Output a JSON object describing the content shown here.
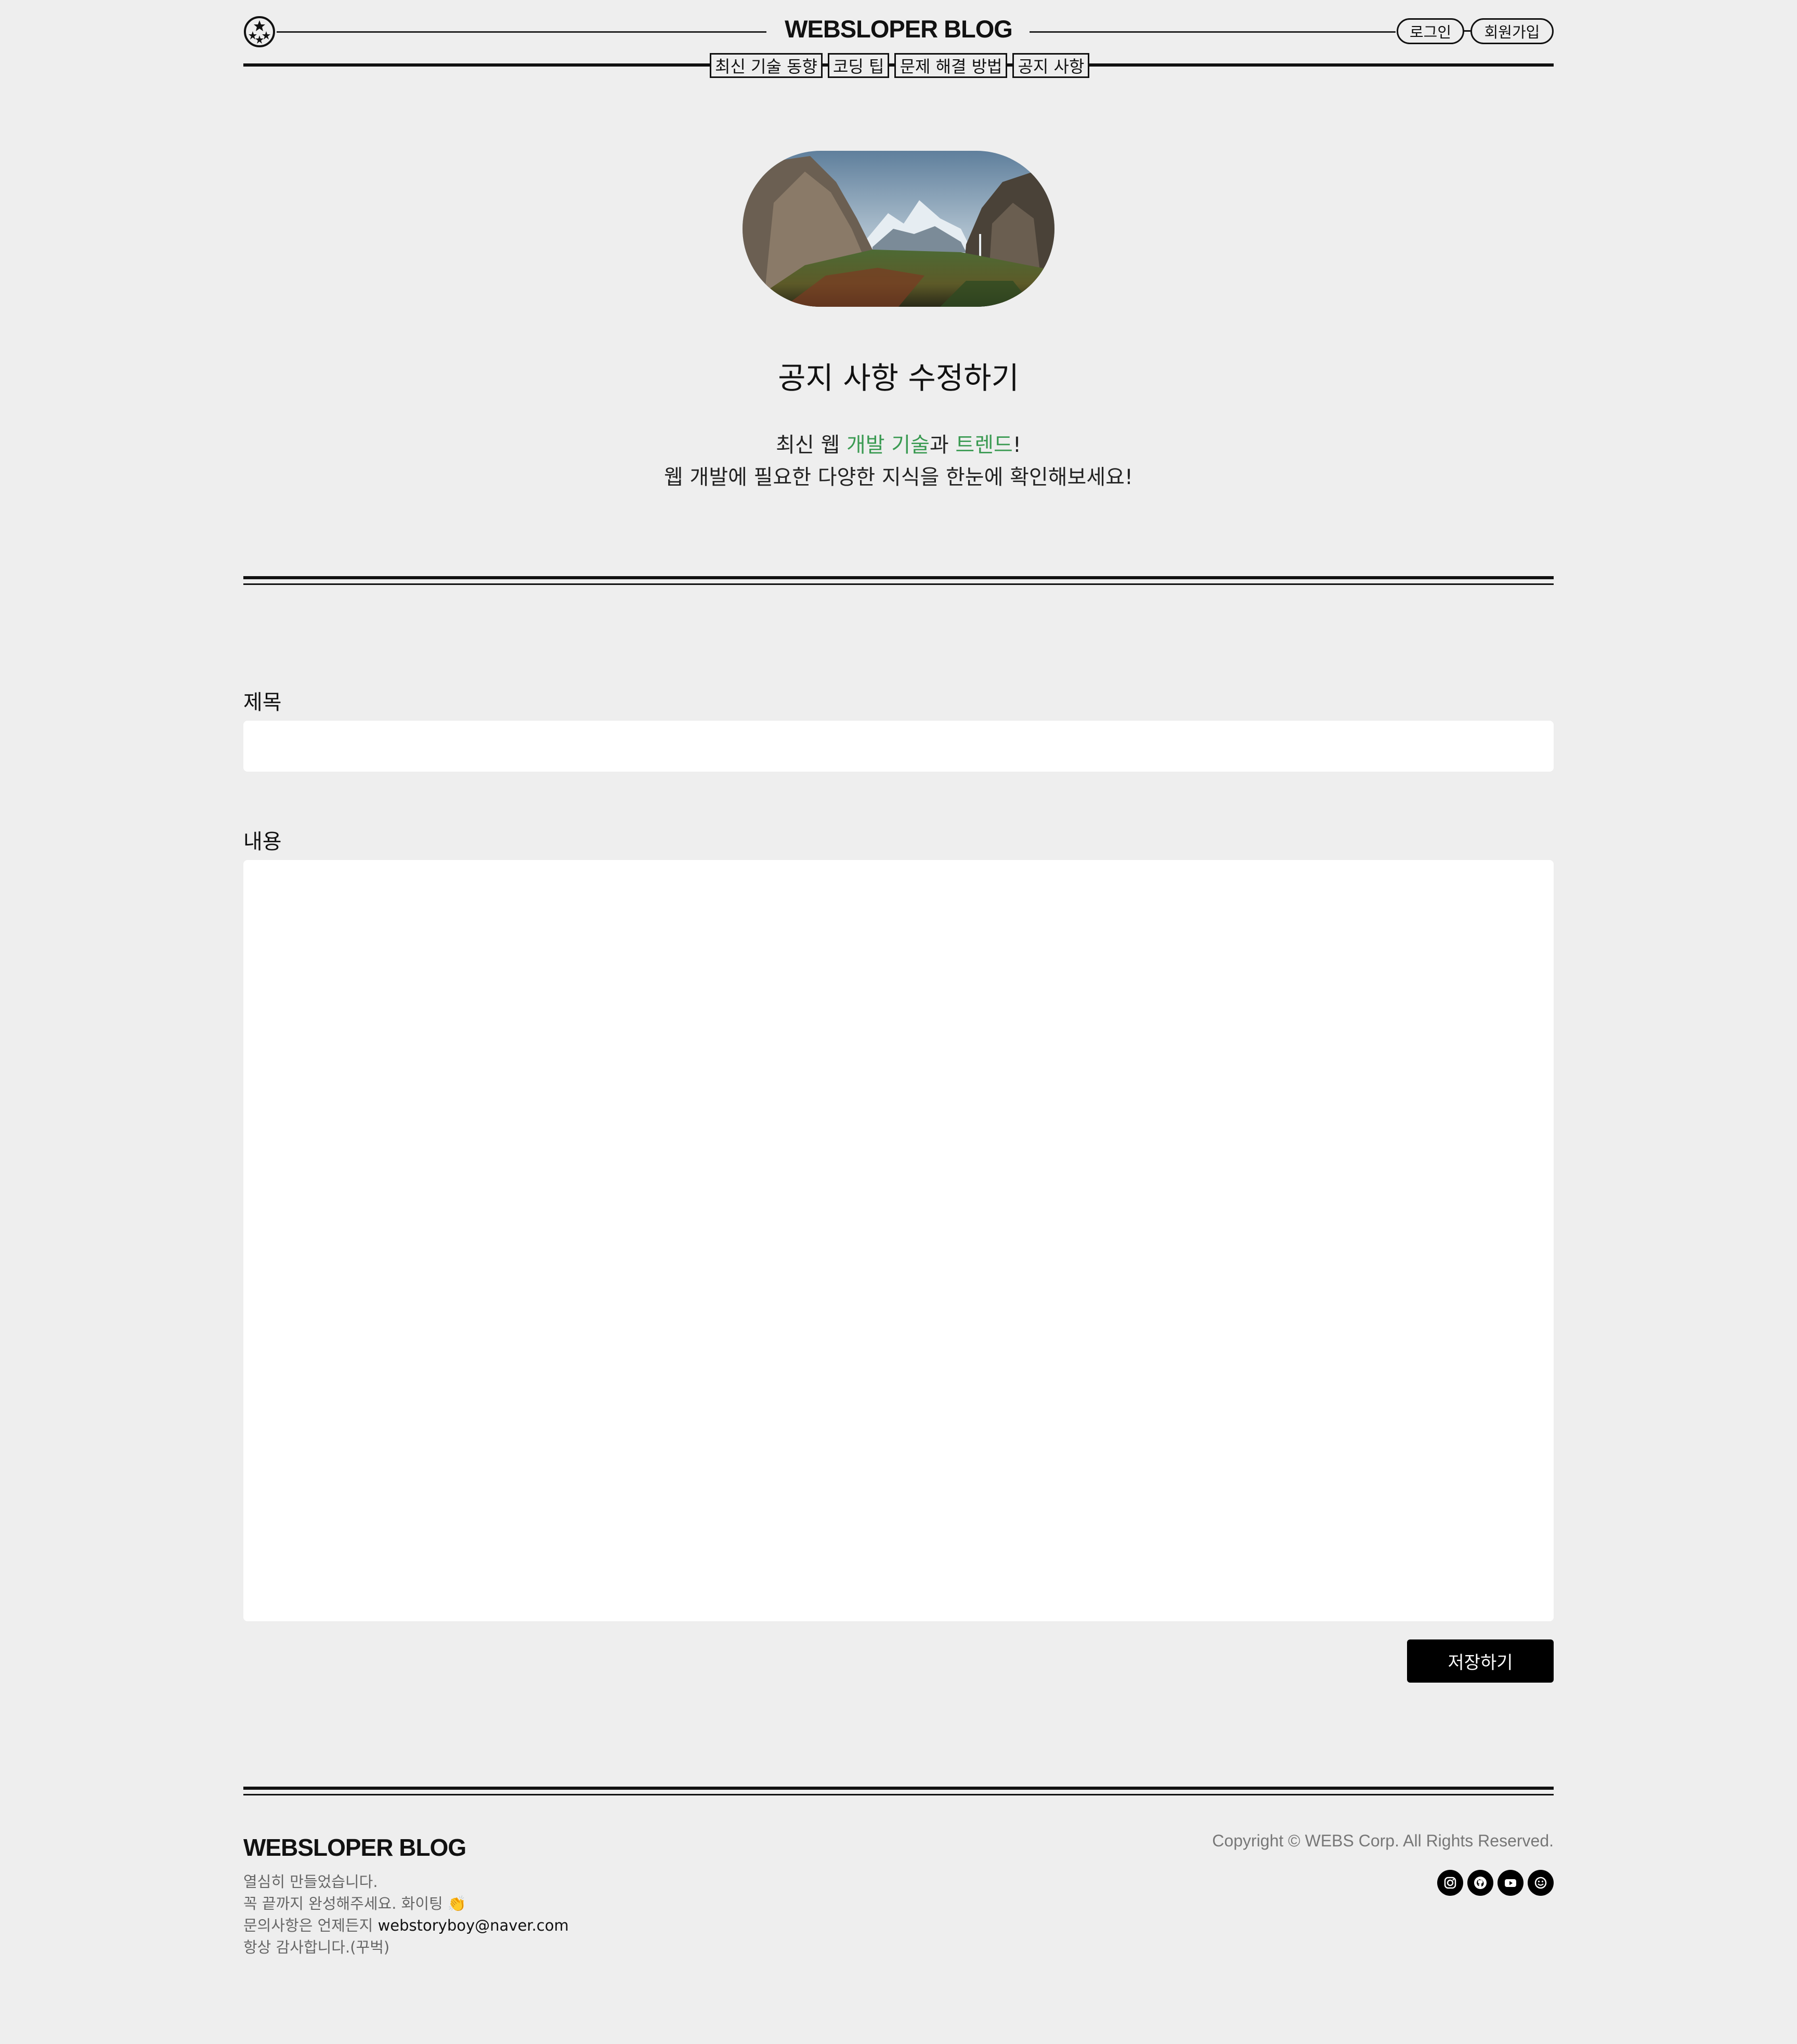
{
  "header": {
    "brand": "WEBSLOPER BLOG",
    "logo_icon": "star-circle-icon",
    "auth": {
      "login": "로그인",
      "signup": "회원가입"
    },
    "nav": [
      "최신 기술 동향",
      "코딩 팁",
      "문제 해결 방법",
      "공지 사항"
    ]
  },
  "hero": {
    "image_alt": "mountain-valley-landscape",
    "title": "공지 사항 수정하기",
    "desc_line1": {
      "before": "최신 웹 ",
      "highlight1": "개발 기술",
      "middle": "과 ",
      "highlight2": "트렌드",
      "after": "!"
    },
    "desc_line2": "웹 개발에 필요한 다양한 지식을 한눈에 확인해보세요!"
  },
  "form": {
    "title_label": "제목",
    "title_value": "",
    "content_label": "내용",
    "content_value": "",
    "save_label": "저장하기"
  },
  "footer": {
    "brand": "WEBSLOPER BLOG",
    "line1": "열심히 만들었습니다.",
    "line2": "꼭 끝까지 완성해주세요. 화이팅 👏",
    "line3_prefix": "문의사항은 언제든지 ",
    "email": "webstoryboy@naver.com",
    "line4": "항상 감사합니다.(꾸벅)",
    "copyright": "Copyright © WEBS Corp. All Rights Reserved.",
    "social_icons": [
      "instagram-icon",
      "github-icon",
      "youtube-icon",
      "smile-icon"
    ]
  },
  "colors": {
    "accent_green": "#3a9a52",
    "background": "#eeeeee"
  }
}
